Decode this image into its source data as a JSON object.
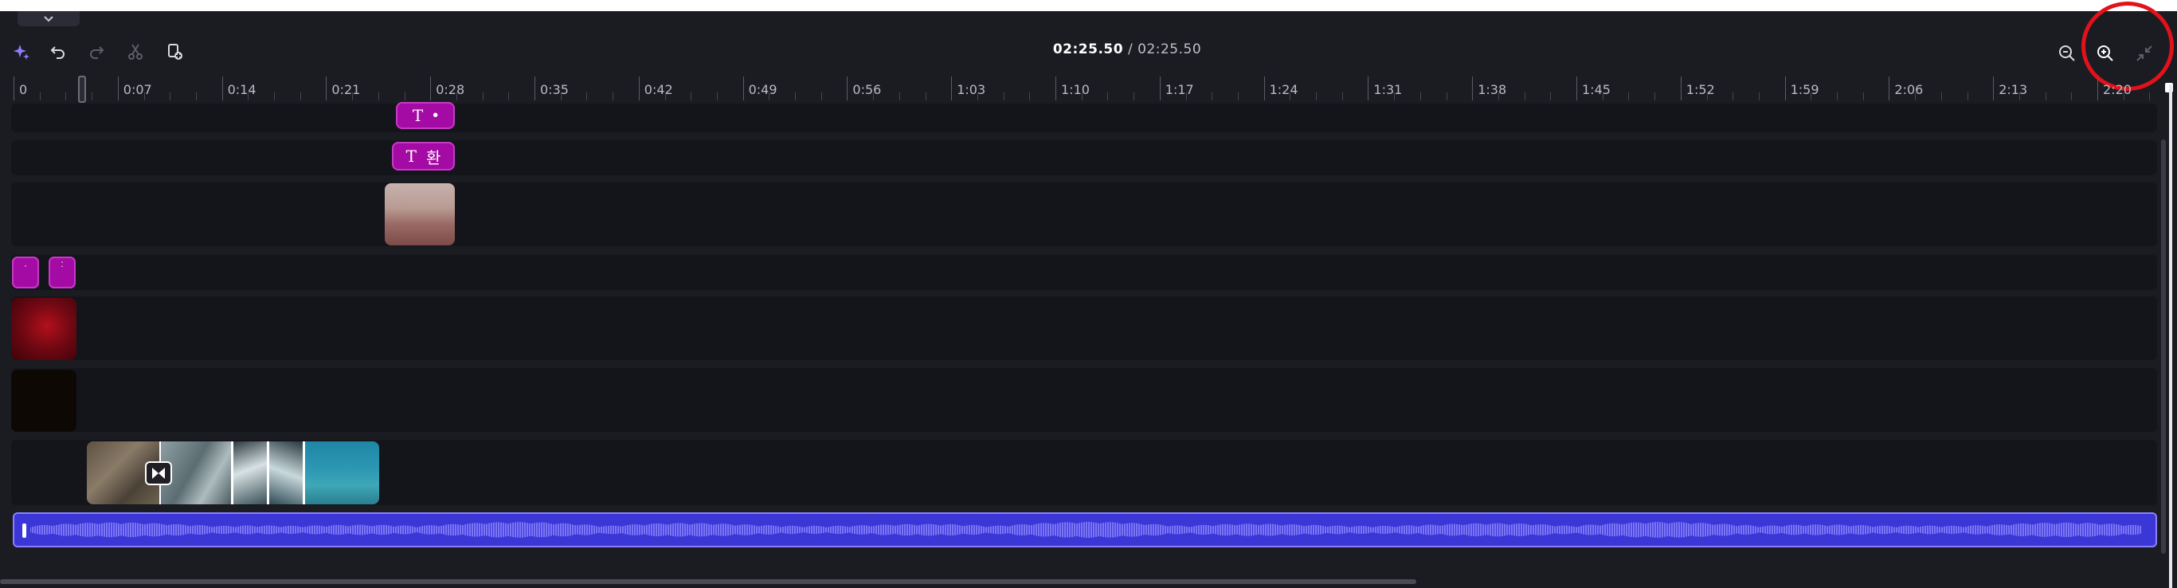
{
  "timecode": {
    "current": "02:25.50",
    "separator": " / ",
    "total": "02:25.50"
  },
  "ruler": {
    "labels": [
      "0",
      "0:07",
      "0:14",
      "0:21",
      "0:28",
      "0:35",
      "0:42",
      "0:49",
      "0:56",
      "1:03",
      "1:10",
      "1:17",
      "1:24",
      "1:31",
      "1:38",
      "1:45",
      "1:52",
      "1:59",
      "2:06",
      "2:13",
      "2:20"
    ]
  },
  "text_clips": {
    "clip1": {
      "glyph": "T",
      "text": "•"
    },
    "clip2": {
      "glyph": "T",
      "text": "환"
    }
  },
  "colors": {
    "background": "#1b1c22",
    "track": "#14151b",
    "text_clip": "#a40ba4",
    "audio_clip": "#3b37d6",
    "highlight": "#e2121b"
  },
  "icons": {
    "magic": "sparkle-icon",
    "undo": "undo-icon",
    "redo": "redo-icon",
    "cut": "scissors-icon",
    "duplicate": "duplicate-icon",
    "zoom_out": "zoom-out-icon",
    "zoom_in": "zoom-in-icon",
    "fit": "fit-timeline-icon",
    "transition": "transition-icon"
  }
}
